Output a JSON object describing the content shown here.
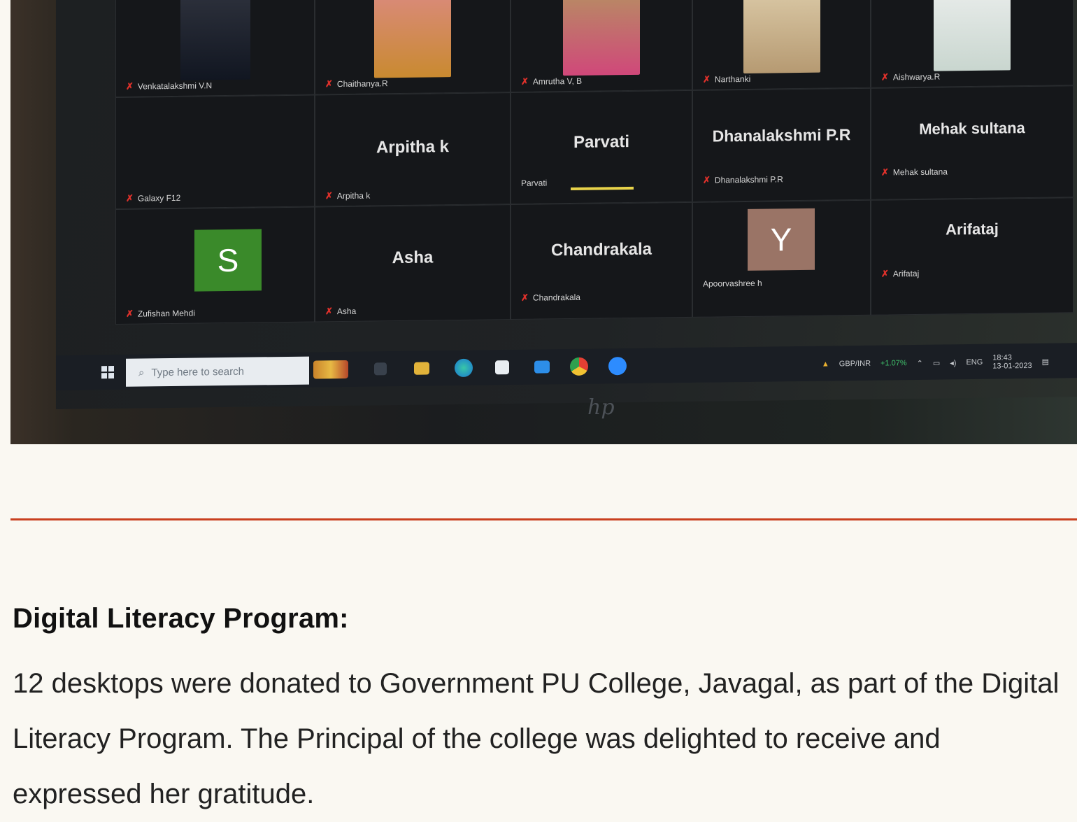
{
  "meeting": {
    "participants": [
      {
        "name": "Venkatalakshmi V.N"
      },
      {
        "name": "Chaithanya.R"
      },
      {
        "name": "Amrutha V, B"
      },
      {
        "name": "Narthanki"
      },
      {
        "name": "Aishwarya.R"
      },
      {
        "name": "Galaxy F12"
      },
      {
        "name": "Arpitha k",
        "display": "Arpitha k"
      },
      {
        "name": "Parvati",
        "display": "Parvati"
      },
      {
        "name": "Dhanalakshmi P.R",
        "display": "Dhanalakshmi P.R"
      },
      {
        "name": "Mehak sultana",
        "display": "Mehak sultana"
      },
      {
        "name": "Zufishan Mehdi",
        "initial": "S"
      },
      {
        "name": "Asha",
        "display": "Asha"
      },
      {
        "name": "Chandrakala",
        "display": "Chandrakala"
      },
      {
        "name": "Apoorvashree h",
        "initial": "Y"
      },
      {
        "name": "Arifataj",
        "display": "Arifataj"
      }
    ],
    "avatar_colors": {
      "S": "#3a8a2a",
      "Y": "#9a7466"
    },
    "mute_icon": "muted-mic-icon"
  },
  "taskbar": {
    "search_placeholder": "Type here to search",
    "ticker": "GBP/INR",
    "ticker_change": "+1.07%",
    "language": "ENG",
    "time": "18:43",
    "date": "13-01-2023"
  },
  "logo": "hp",
  "article": {
    "heading": "Digital Literacy Program:",
    "body": "12 desktops were donated to Government PU College, Javagal, as part of the Digital Literacy Program. The Principal of the college was delighted to receive and expressed her gratitude."
  }
}
